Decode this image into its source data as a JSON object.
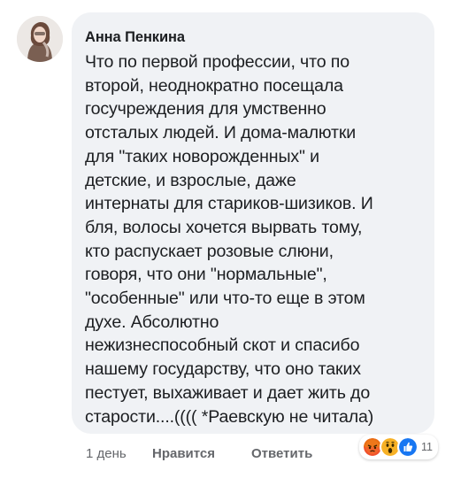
{
  "comment": {
    "author": "Анна Пенкина",
    "text": "Что по первой профессии, что по\nвторой, неоднократно посещала\nгосучреждения для умственно\nотсталых людей. И дома-малютки\nдля \"таких новорожденных\" и\nдетские, и взрослые, даже\nинтернаты для стариков-шизиков. И\nбля, волосы хочется вырвать тому,\nкто распускает розовые слюни,\nговоря, что они \"нормальные\",\n\"особенные\" или что-то еще в этом\nдухе. Абсолютно\nнежизнеспособный скот и спасибо\nнашему государству, что оно таких\nпестует, выхаживает и дает жить до\nстарости....(((( *Раевскую не читала)"
  },
  "footer": {
    "time": "1 день",
    "like_label": "Нравится",
    "reply_label": "Ответить"
  },
  "reactions": {
    "icons": [
      "angry-reaction-icon",
      "wow-reaction-icon",
      "like-reaction-icon"
    ],
    "count": "11",
    "colors": {
      "angry": "#e9710f",
      "wow": "#f7b125",
      "like": "#1877f2"
    }
  }
}
